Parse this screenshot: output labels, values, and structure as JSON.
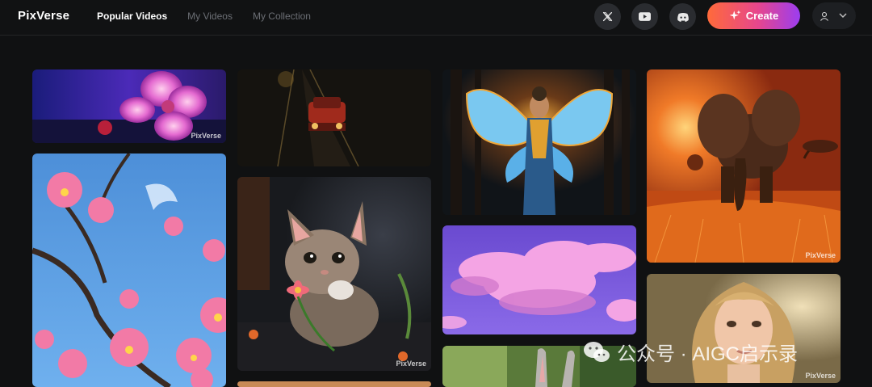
{
  "app": {
    "logo_text": "PixVerse"
  },
  "nav": {
    "items": [
      {
        "label": "Popular Videos",
        "active": true
      },
      {
        "label": "My Videos",
        "active": false
      },
      {
        "label": "My Collection",
        "active": false
      }
    ]
  },
  "header_actions": {
    "icons": [
      "x-twitter-icon",
      "youtube-icon",
      "discord-icon"
    ],
    "create_label": "Create",
    "create_icon": "sparkle-icon",
    "user_icon": "user-icon",
    "chevron_icon": "chevron-down-icon"
  },
  "gallery": {
    "watermark": "PixVerse",
    "cards": [
      {
        "subject": "pink blossom on purple"
      },
      {
        "subject": "red car on dark road"
      },
      {
        "subject": "butterfly fairy in forest"
      },
      {
        "subject": "elephant at sunset"
      },
      {
        "subject": "pink blossoms blue sky"
      },
      {
        "subject": "kitten with flower"
      },
      {
        "subject": "pink clouds"
      },
      {
        "subject": "blonde woman portrait"
      },
      {
        "subject": "rabbit"
      },
      {
        "subject": "partial card"
      }
    ]
  },
  "overlay": {
    "text": "公众号 · AIGC启示录"
  },
  "colors": {
    "background": "#101112",
    "header_bg": "#111213",
    "nav_active": "#ffffff",
    "nav_inactive": "#6c6f75",
    "icon_bg": "#2a2c30",
    "create_gradient_start": "#ff6a3a",
    "create_gradient_end": "#9b3df0"
  }
}
